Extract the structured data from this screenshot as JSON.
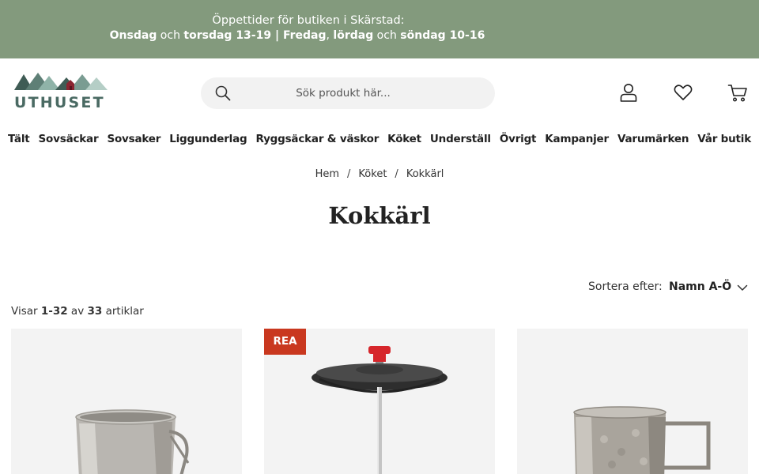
{
  "announcement": {
    "line1": "Öppettider för butiken i Skärstad:",
    "days1": "Onsdag",
    "and1": " och ",
    "days2": "torsdag 13-19 | Fredag",
    "comma": ", ",
    "days3": "lördag",
    "and2": " och ",
    "days4": "söndag 10-16"
  },
  "brand": {
    "name": "UTHUSET"
  },
  "search": {
    "placeholder": "Sök produkt här..."
  },
  "header_icons": [
    "user-icon",
    "heart-icon",
    "cart-icon"
  ],
  "nav": {
    "items": [
      "Tält",
      "Sovsäckar",
      "Sovsaker",
      "Liggunderlag",
      "Ryggsäckar & väskor",
      "Köket",
      "Underställ",
      "Övrigt",
      "Kampanjer",
      "Varumärken",
      "Vår butik"
    ]
  },
  "breadcrumb": {
    "items": [
      "Hem",
      "Köket",
      "Kokkärl"
    ],
    "separator": "/"
  },
  "page": {
    "title": "Kokkärl"
  },
  "sort": {
    "label": "Sortera efter:",
    "value": "Namn A-Ö"
  },
  "listing": {
    "prefix": "Visar ",
    "range": "1-32",
    "middle": " av ",
    "total": "33",
    "suffix": " artiklar"
  },
  "products": [
    {
      "badge": ""
    },
    {
      "badge": "REA"
    },
    {
      "badge": ""
    }
  ],
  "colors": {
    "announcement_bg": "#839a7d",
    "sale_badge": "#c9381f",
    "brand": "#4a6a63",
    "card_bg": "#f3f3f3"
  }
}
